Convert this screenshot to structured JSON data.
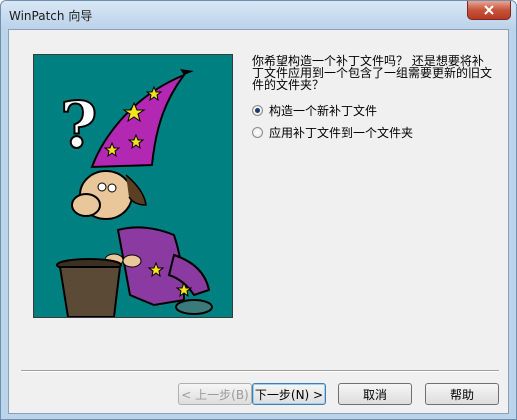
{
  "window": {
    "title": "WinPatch 向导",
    "close_icon": "close-icon"
  },
  "wizard": {
    "question_lines": [
      "你希望构造一个补丁文件吗？ 还是想要将补",
      "丁文件应用到一个包含了一组需要更新的旧文",
      "件的文件夹？"
    ],
    "options": [
      {
        "label": "构造一个新补丁文件",
        "selected": true
      },
      {
        "label": "应用补丁文件到一个文件夹",
        "selected": false
      }
    ],
    "illustration": "wizard-with-top-hat-illustration",
    "illustration_bg": "#008080"
  },
  "buttons": {
    "back": "< 上一步(B)",
    "next": "下一步(N) >",
    "cancel": "取消",
    "help": "帮助"
  }
}
